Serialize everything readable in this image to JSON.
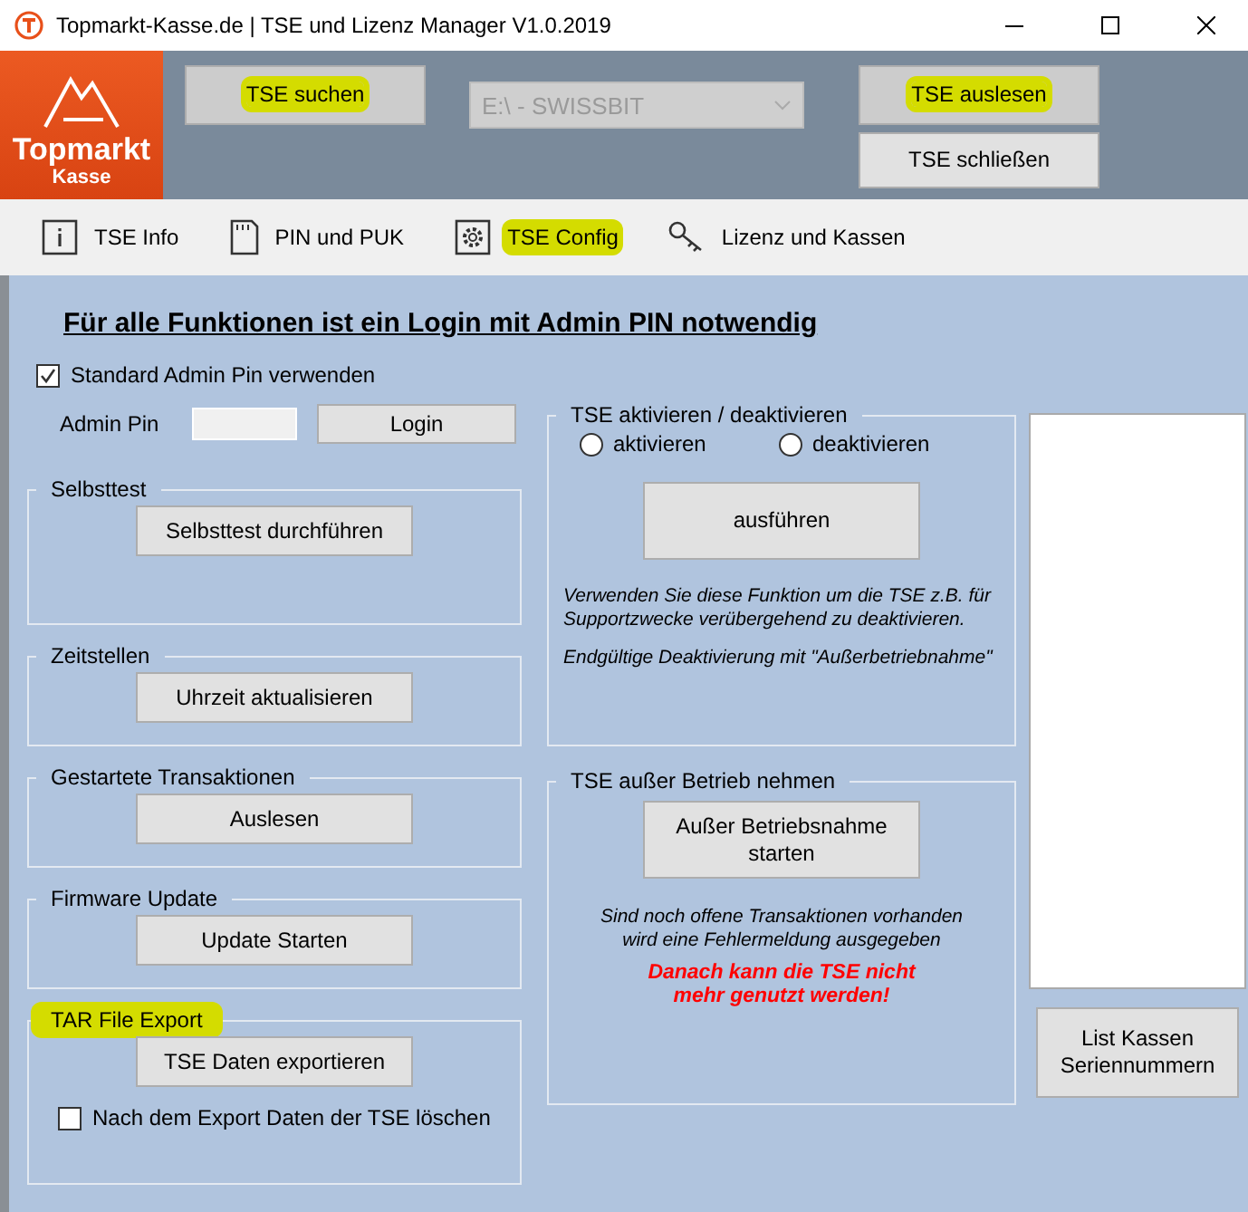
{
  "window": {
    "title": "Topmarkt-Kasse.de | TSE  und Lizenz Manager V1.0.2019"
  },
  "logo": {
    "name": "Topmarkt",
    "sub": "Kasse"
  },
  "toolbar": {
    "search_button": {
      "label": "TSE suchen",
      "highlighted": true
    },
    "device_select": {
      "value": "E:\\ - SWISSBIT",
      "disabled": true
    },
    "read_button": {
      "label": "TSE auslesen",
      "highlighted": true
    },
    "close_button": {
      "label": "TSE schließen",
      "highlighted": false
    }
  },
  "tabs": [
    {
      "kind": "info",
      "label": "TSE Info",
      "highlighted": false
    },
    {
      "kind": "card",
      "label": "PIN und PUK",
      "highlighted": false
    },
    {
      "kind": "gear",
      "label": "TSE Config",
      "highlighted": true
    },
    {
      "kind": "key",
      "label": "Lizenz und Kassen",
      "highlighted": false
    }
  ],
  "heading": "Für alle Funktionen ist ein Login mit Admin PIN notwendig",
  "standard_pin": {
    "label": "Standard Admin Pin verwenden",
    "checked": true
  },
  "admin_pin": {
    "label": "Admin Pin",
    "button": "Login"
  },
  "left_groups": [
    {
      "title": "Selbsttest",
      "highlighted": false,
      "button": "Selbsttest durchführen"
    },
    {
      "title": "Zeitstellen",
      "highlighted": false,
      "button": "Uhrzeit aktualisieren"
    },
    {
      "title": "Gestartete Transaktionen",
      "highlighted": false,
      "button": "Auslesen"
    },
    {
      "title": "Firmware Update",
      "highlighted": false,
      "button": "Update Starten"
    },
    {
      "title": "TAR File Export",
      "highlighted": true,
      "button": "TSE Daten exportieren",
      "checkbox": {
        "label": "Nach dem Export Daten der TSE löschen",
        "checked": false
      }
    }
  ],
  "activation": {
    "title": "TSE aktivieren / deaktivieren",
    "radios": [
      {
        "label": "aktivieren",
        "selected": false
      },
      {
        "label": "deaktivieren",
        "selected": false
      }
    ],
    "button": "ausführen",
    "notes": [
      "Verwenden Sie diese Funktion um die TSE z.B. für Supportzwecke verübergehend zu deaktivieren.",
      "Endgültige Deaktivierung mit \"Außerbetriebnahme\""
    ]
  },
  "decommission": {
    "title": "TSE außer Betrieb nehmen",
    "button": "Außer Betriebsnahme\nstarten",
    "note": "Sind noch offene Transaktionen vorhanden\nwird eine Fehlermeldung ausgegeben",
    "warning": "Danach kann die TSE nicht\nmehr genutzt werden!"
  },
  "list_button": "List Kassen\nSeriennummern"
}
